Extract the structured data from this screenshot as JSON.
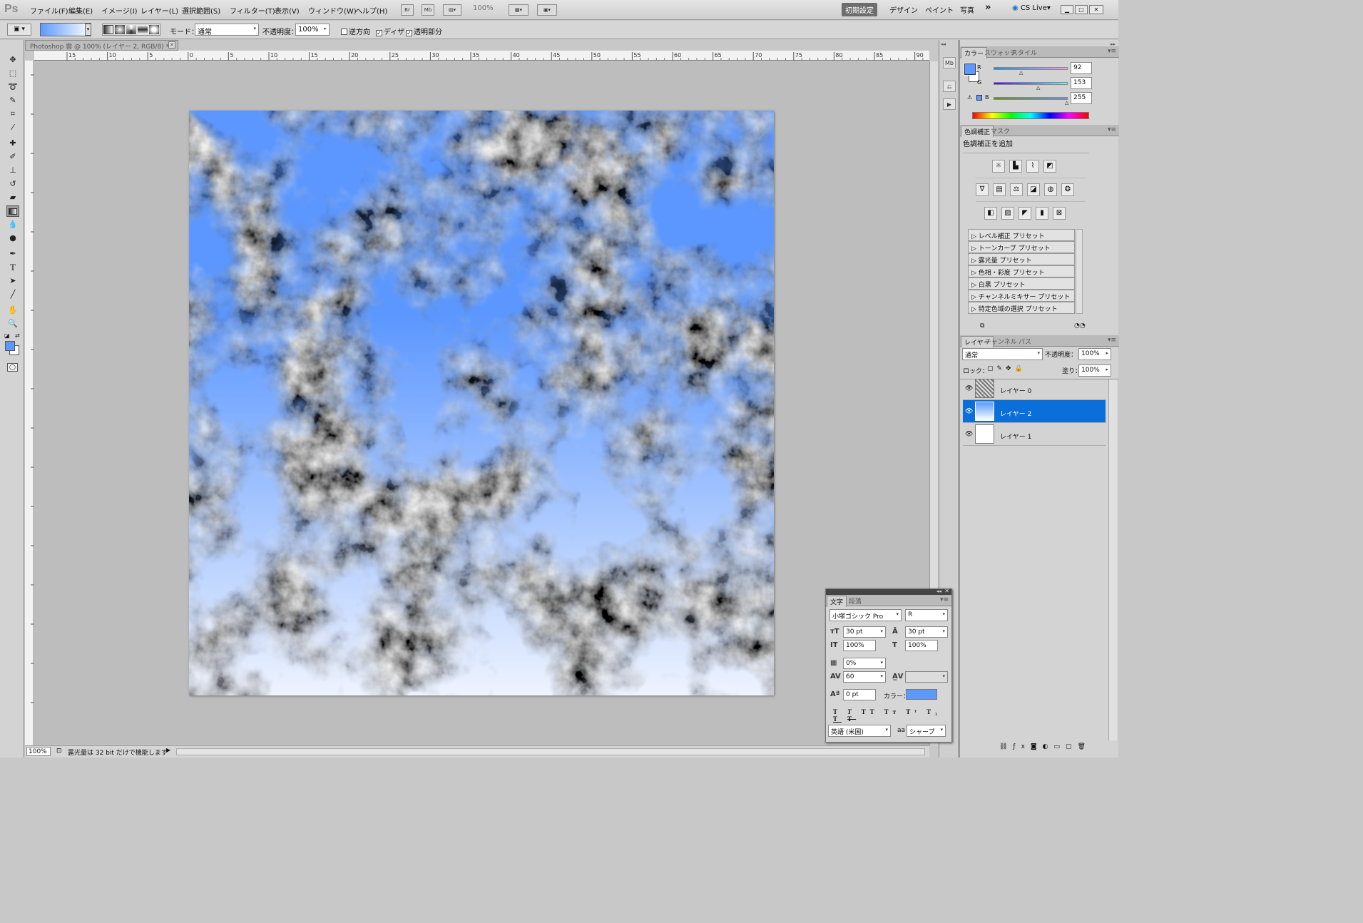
{
  "app": {
    "logo": "Ps"
  },
  "menu": [
    "ファイル(F)",
    "編集(E)",
    "イメージ(I)",
    "レイヤー(L)",
    "選択範囲(S)",
    "フィルター(T)",
    "表示(V)",
    "ウィンドウ(W)",
    "ヘルプ(H)"
  ],
  "appbar": {
    "bridge": "Br",
    "minibridge": "Mb",
    "zoom": "100%"
  },
  "workspaces": {
    "active": "初期設定",
    "items": [
      "デザイン",
      "ペイント",
      "写真"
    ],
    "more": "»",
    "cslive": "CS Live"
  },
  "options": {
    "mode_label": "モード：",
    "mode_value": "通常",
    "opacity_label": "不透明度：",
    "opacity_value": "100%",
    "reverse": "逆方向",
    "dither": "ディザ",
    "transparency": "透明部分"
  },
  "document": {
    "tab_title": "Photoshop 雲 @ 100% (レイヤー 2, RGB/8) *",
    "close": "×",
    "zoom": "100%",
    "status": "露光量は 32 bit だけで機能します"
  },
  "ruler": {
    "h_ticks": [
      "15",
      "10",
      "5",
      "0",
      "5",
      "10",
      "15",
      "20",
      "25",
      "30",
      "35",
      "40",
      "45",
      "50",
      "55",
      "60",
      "65",
      "70",
      "75",
      "80",
      "85",
      "90"
    ]
  },
  "colors": {
    "foreground": "#5c99ff",
    "background": "#ffffff",
    "accent_selection": "#0a6fd8",
    "sky_top": "#5b97ff",
    "sky_bottom": "#eef3ff"
  },
  "color_panel": {
    "tabs": [
      "カラー",
      "スウォッチ",
      "スタイル"
    ],
    "r_label": "R",
    "r": "92",
    "g_label": "G",
    "g": "153",
    "b_label": "B",
    "b": "255"
  },
  "adjust_panel": {
    "tabs": [
      "色調補正",
      "マスク"
    ],
    "title": "色調補正を追加",
    "presets": [
      "レベル補正 プリセット",
      "トーンカーブ プリセット",
      "露光量 プリセット",
      "色相・彩度 プリセット",
      "白黒 プリセット",
      "チャンネルミキサー プリセット",
      "特定色域の選択 プリセット"
    ]
  },
  "layers_panel": {
    "tabs": [
      "レイヤー",
      "チャンネル",
      "パス"
    ],
    "blend": "通常",
    "opacity_label": "不透明度：",
    "opacity": "100%",
    "lock_label": "ロック：",
    "fill_label": "塗り：",
    "fill": "100%",
    "layers": [
      {
        "name": "レイヤー 0"
      },
      {
        "name": "レイヤー 2"
      },
      {
        "name": "レイヤー 1"
      }
    ]
  },
  "char_panel": {
    "tabs": [
      "文字",
      "段落"
    ],
    "font": "小塚ゴシック Pro",
    "style": "R",
    "size": "30 pt",
    "leading": "30 pt",
    "vscale": "100%",
    "hscale": "100%",
    "tsume": "0%",
    "tracking": "60",
    "baseline": "0 pt",
    "color_label": "カラー：",
    "language": "英語 (米国)",
    "aa_label": "aa",
    "antialias": "シャープ"
  }
}
